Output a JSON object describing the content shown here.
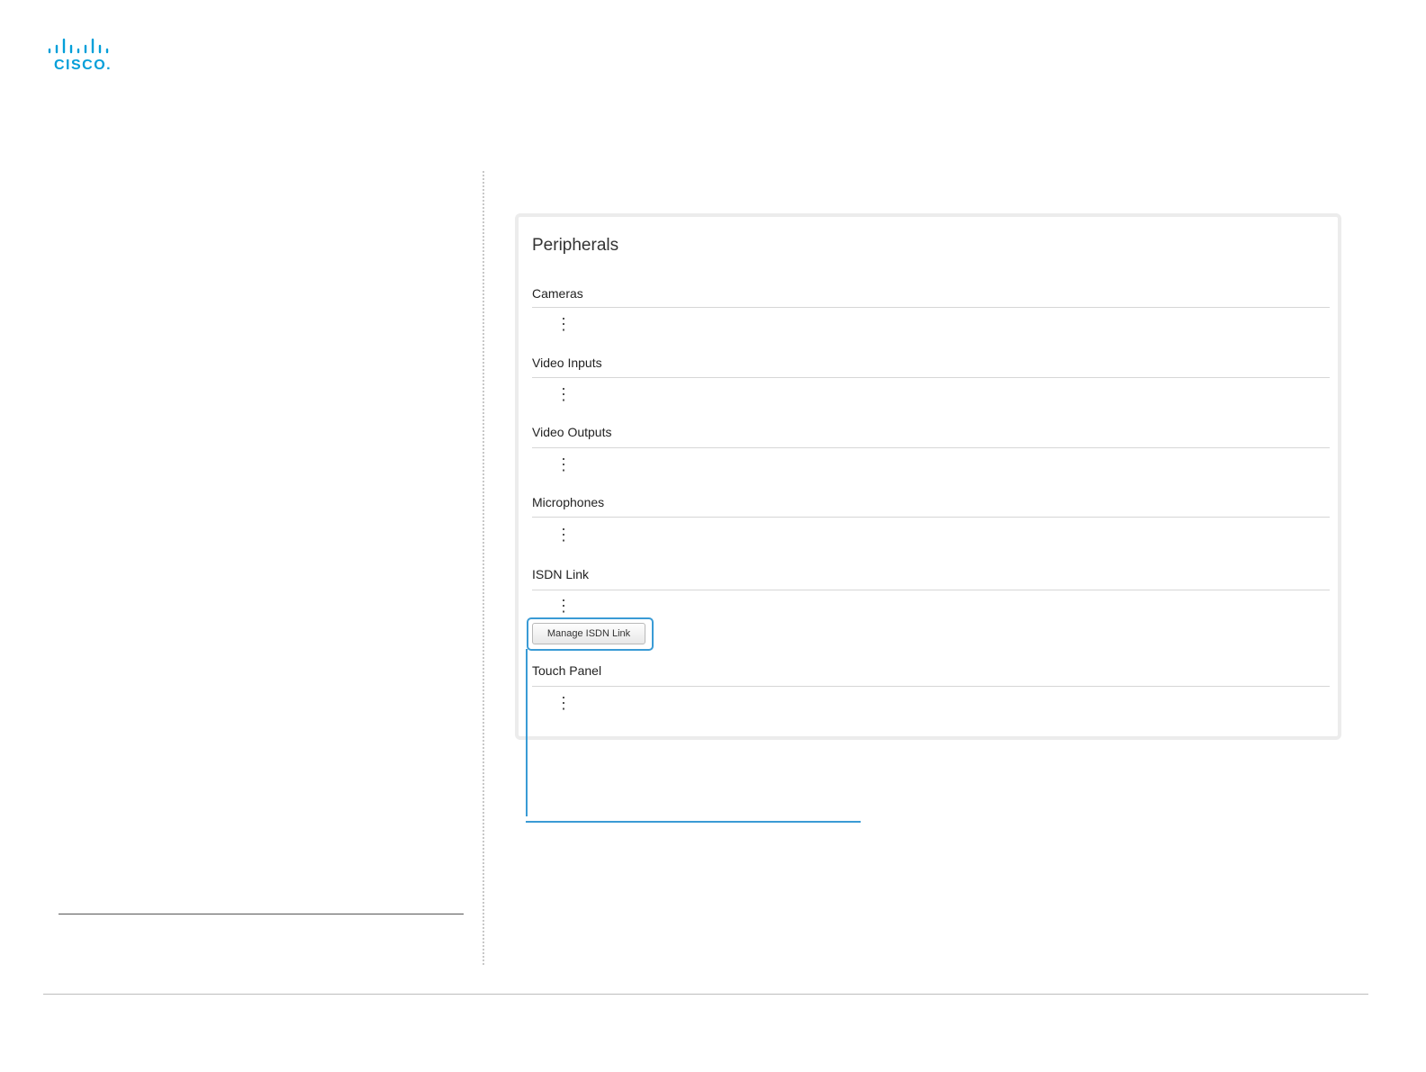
{
  "brand": {
    "logo_name": "cisco-logo",
    "logo_text": "cisco",
    "accent_color": "#049fd9"
  },
  "panel": {
    "title": "Peripherals",
    "sections": [
      {
        "label": "Cameras",
        "more_icon": "⋮"
      },
      {
        "label": "Video Inputs",
        "more_icon": "⋮"
      },
      {
        "label": "Video Outputs",
        "more_icon": "⋮"
      },
      {
        "label": "Microphones",
        "more_icon": "⋮"
      },
      {
        "label": "ISDN Link",
        "more_icon": "⋮"
      },
      {
        "label": "Touch Panel",
        "more_icon": "⋮"
      }
    ],
    "manage_isdn_button": "Manage ISDN Link"
  },
  "colors": {
    "highlight": "#3a9bd5",
    "panel_border": "#ececec"
  }
}
